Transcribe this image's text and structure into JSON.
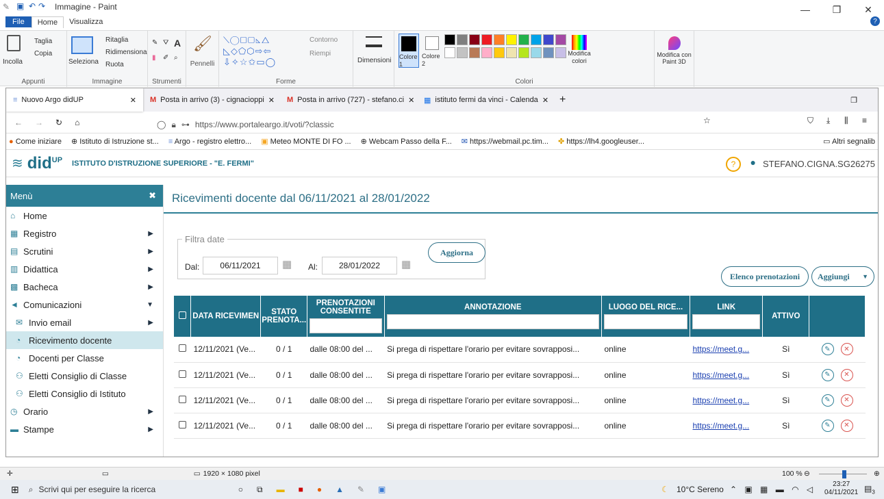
{
  "paint": {
    "title": "Immagine - Paint",
    "tabs": [
      "File",
      "Home",
      "Visualizza"
    ],
    "groups": {
      "clipboard": {
        "paste": "Incolla",
        "cut": "Taglia",
        "copy": "Copia",
        "label": "Appunti"
      },
      "image": {
        "select": "Seleziona",
        "crop": "Ritaglia",
        "resize": "Ridimensiona",
        "rotate": "Ruota",
        "label": "Immagine"
      },
      "tools": {
        "label": "Strumenti"
      },
      "brushes": {
        "label": "Pennelli"
      },
      "shapes": {
        "outline": "Contorno",
        "fill": "Riempi",
        "label": "Forme"
      },
      "size": {
        "label": "Dimensioni"
      },
      "colors": {
        "color1": "Colore 1",
        "color2": "Colore 2",
        "edit": "Modifica colori",
        "paint3d": "Modifica con Paint 3D",
        "label": "Colori"
      }
    },
    "palette_row1": [
      "#000000",
      "#7f7f7f",
      "#880015",
      "#ed1c24",
      "#ff7f27",
      "#fff200",
      "#22b14c",
      "#00a2e8",
      "#3f48cc",
      "#a349a4"
    ],
    "palette_row2": [
      "#ffffff",
      "#c3c3c3",
      "#b97a57",
      "#ffaec9",
      "#ffc90e",
      "#efe4b0",
      "#b5e61d",
      "#99d9ea",
      "#7092be",
      "#c8bfe7"
    ],
    "status": {
      "dimensions": "1920 × 1080 pixel",
      "zoom": "100 %"
    }
  },
  "browser": {
    "tabs": [
      {
        "label": "Nuovo Argo didUP",
        "active": true
      },
      {
        "label": "Posta in arrivo (3) - cignacioppi",
        "active": false
      },
      {
        "label": "Posta in arrivo (727) - stefano.ci",
        "active": false
      },
      {
        "label": "istituto fermi da vinci - Calenda",
        "active": false
      }
    ],
    "url": "https://www.portaleargo.it/voti/?classic",
    "url_domain": "portaleargo.it",
    "bookmarks": [
      "Come iniziare",
      "Istituto di Istruzione st...",
      "Argo - registro elettro...",
      "Meteo MONTE DI FO ...",
      "Webcam Passo della F...",
      "https://webmail.pc.tim...",
      "https://lh4.googleuser..."
    ],
    "other_bookmarks": "Altri segnalib"
  },
  "app": {
    "logo": "did",
    "logo_sup": "UP",
    "school": "ISTITUTO D'ISTRUZIONE SUPERIORE - \"E. FERMI\"",
    "user": "STEFANO.CIGNA.SG26275",
    "menu_title": "Menù",
    "menu": [
      {
        "label": "Home",
        "icon": "home-icon",
        "sub": false,
        "arrow": false
      },
      {
        "label": "Registro",
        "icon": "calendar-icon",
        "sub": false,
        "arrow": true
      },
      {
        "label": "Scrutini",
        "icon": "document-icon",
        "sub": false,
        "arrow": true
      },
      {
        "label": "Didattica",
        "icon": "book-icon",
        "sub": false,
        "arrow": true
      },
      {
        "label": "Bacheca",
        "icon": "board-icon",
        "sub": false,
        "arrow": true
      },
      {
        "label": "Comunicazioni",
        "icon": "megaphone-icon",
        "sub": false,
        "arrow": "down"
      },
      {
        "label": "Invio email",
        "icon": "envelope-icon",
        "sub": true,
        "arrow": true
      },
      {
        "label": "Ricevimento docente",
        "icon": "chat-icon",
        "sub": true,
        "arrow": false,
        "active": true
      },
      {
        "label": "Docenti per Classe",
        "icon": "chat-icon",
        "sub": true,
        "arrow": false
      },
      {
        "label": "Eletti Consiglio di Classe",
        "icon": "group-icon",
        "sub": true,
        "arrow": false
      },
      {
        "label": "Eletti Consiglio di Istituto",
        "icon": "group-icon",
        "sub": true,
        "arrow": false
      },
      {
        "label": "Orario",
        "icon": "clock-icon",
        "sub": false,
        "arrow": true
      },
      {
        "label": "Stampe",
        "icon": "print-icon",
        "sub": false,
        "arrow": true
      }
    ],
    "page_title": "Ricevimenti docente dal 06/11/2021 al 28/01/2022",
    "filter": {
      "legend": "Filtra date",
      "from_label": "Dal:",
      "from": "06/11/2021",
      "to_label": "Al:",
      "to": "28/01/2022",
      "update": "Aggiorna"
    },
    "actions": {
      "bookings": "Elenco prenotazioni",
      "add": "Aggiungi"
    },
    "columns": [
      "DATA RICEVIMEN",
      "STATO PRENOTA...",
      "PRENOTAZIONI CONSENTITE",
      "ANNOTAZIONE",
      "LUOGO DEL RICE...",
      "LINK",
      "ATTIVO"
    ],
    "rows": [
      {
        "date": "12/11/2021 (Ve...",
        "state": "0 / 1",
        "allowed": "dalle 08:00 del ...",
        "note": "Si prega di rispettare l'orario per evitare sovrapposi...",
        "place": "online",
        "link": "https://meet.g...",
        "active": "Sì"
      },
      {
        "date": "12/11/2021 (Ve...",
        "state": "0 / 1",
        "allowed": "dalle 08:00 del ...",
        "note": "Si prega di rispettare l'orario per evitare sovrapposi...",
        "place": "online",
        "link": "https://meet.g...",
        "active": "Sì"
      },
      {
        "date": "12/11/2021 (Ve...",
        "state": "0 / 1",
        "allowed": "dalle 08:00 del ...",
        "note": "Si prega di rispettare l'orario per evitare sovrapposi...",
        "place": "online",
        "link": "https://meet.g...",
        "active": "Sì"
      },
      {
        "date": "12/11/2021 (Ve...",
        "state": "0 / 1",
        "allowed": "dalle 08:00 del ...",
        "note": "Si prega di rispettare l'orario per evitare sovrapposi...",
        "place": "online",
        "link": "https://meet.g...",
        "active": "Sì"
      }
    ]
  },
  "taskbar": {
    "search": "Scrivi qui per eseguire la ricerca",
    "weather": "10°C Sereno",
    "time": "23:27",
    "date": "04/11/2021",
    "notifications": "3"
  },
  "colors": {
    "accent": "#2d7f96",
    "header": "#1f6f87",
    "active_menu": "#cfe7ed"
  }
}
